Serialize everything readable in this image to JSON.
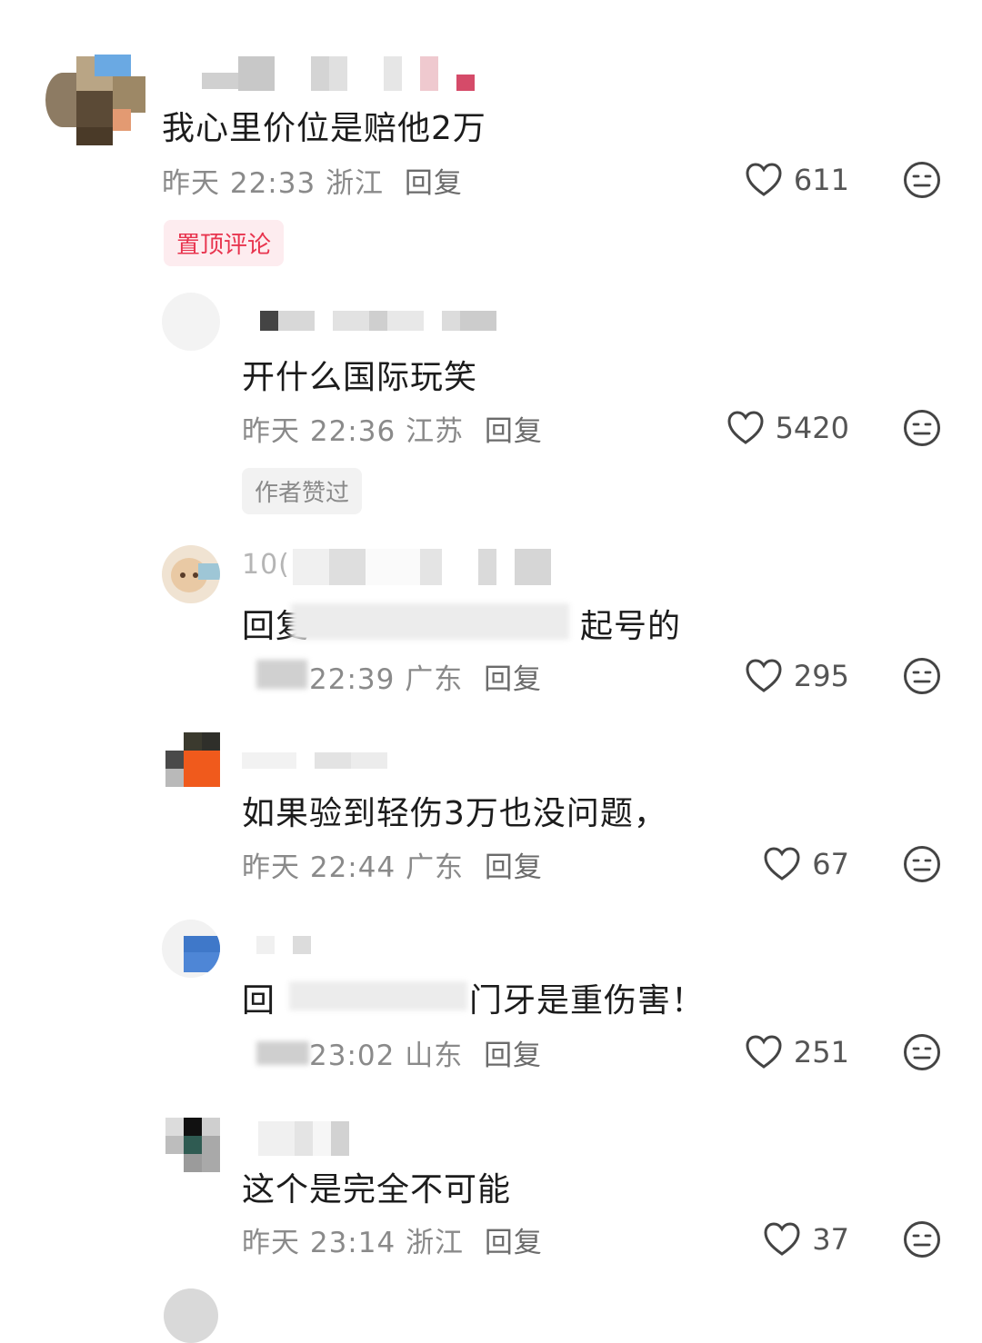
{
  "comments": [
    {
      "text": "我心里价位是赔他2万",
      "date": "昨天",
      "time": "22:33",
      "location": "浙江",
      "reply_label": "回复",
      "likes": "611",
      "badge": "置顶评论"
    },
    {
      "text": "开什么国际玩笑",
      "date": "昨天",
      "time": "22:36",
      "location": "江苏",
      "reply_label": "回复",
      "likes": "5420",
      "badge": "作者赞过"
    },
    {
      "username_visible": "10(",
      "text_prefix": "回复",
      "text_suffix": "起号的",
      "time_partial": "22:39",
      "location": "广东",
      "reply_label": "回复",
      "likes": "295"
    },
    {
      "text": "如果验到轻伤3万也没问题，",
      "date": "昨天",
      "time": "22:44",
      "location": "广东",
      "reply_label": "回复",
      "likes": "67"
    },
    {
      "text_prefix": "回",
      "text_suffix": "门牙是重伤害！",
      "time_partial": "23:02",
      "location": "山东",
      "reply_label": "回复",
      "likes": "251"
    },
    {
      "text": "这个是完全不可能",
      "date": "昨天",
      "time": "23:14",
      "location": "浙江",
      "reply_label": "回复",
      "likes": "37"
    }
  ],
  "colors": {
    "pin_badge_text": "#e8344e",
    "pin_badge_bg": "#fdecef",
    "meta_gray": "#8a8a8a",
    "icon_gray": "#444444"
  },
  "icons": {
    "like": "heart-outline-icon",
    "dislike": "neutral-face-icon"
  }
}
